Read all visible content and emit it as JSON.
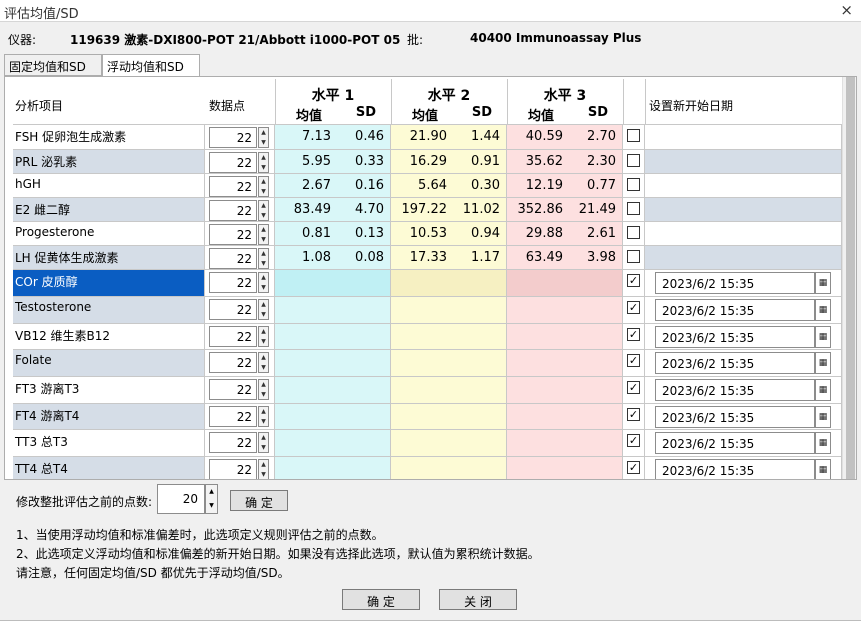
{
  "window": {
    "title": "评估均值/SD",
    "close_glyph": "×"
  },
  "info": {
    "instrument_label": "仪器:",
    "instrument_value": "119639 激素-DXI800-POT 21/Abbott i1000-POT 05",
    "lot_label": "批:",
    "lot_value": "40400 Immunoassay Plus"
  },
  "tabs": [
    {
      "label": "固定均值和SD",
      "active": false
    },
    {
      "label": "浮动均值和SD",
      "active": true
    }
  ],
  "table": {
    "headers": {
      "analyte": "分析项目",
      "count": "数据点",
      "level1": "水平 1",
      "level2": "水平 2",
      "level3": "水平 3",
      "mean": "均值",
      "sd": "SD",
      "new_start": "设置新开始日期"
    },
    "rows": [
      {
        "name": "FSH 促卵泡生成激素",
        "count": "22",
        "m1": "7.13",
        "s1": "0.46",
        "m2": "21.90",
        "s2": "1.44",
        "m3": "40.59",
        "s3": "2.70",
        "checked": false,
        "date": ""
      },
      {
        "name": "PRL 泌乳素",
        "count": "22",
        "m1": "5.95",
        "s1": "0.33",
        "m2": "16.29",
        "s2": "0.91",
        "m3": "35.62",
        "s3": "2.30",
        "checked": false,
        "date": ""
      },
      {
        "name": "hGH",
        "count": "22",
        "m1": "2.67",
        "s1": "0.16",
        "m2": "5.64",
        "s2": "0.30",
        "m3": "12.19",
        "s3": "0.77",
        "checked": false,
        "date": ""
      },
      {
        "name": "E2 雌二醇",
        "count": "22",
        "m1": "83.49",
        "s1": "4.70",
        "m2": "197.22",
        "s2": "11.02",
        "m3": "352.86",
        "s3": "21.49",
        "checked": false,
        "date": ""
      },
      {
        "name": "Progesterone",
        "count": "22",
        "m1": "0.81",
        "s1": "0.13",
        "m2": "10.53",
        "s2": "0.94",
        "m3": "29.88",
        "s3": "2.61",
        "checked": false,
        "date": ""
      },
      {
        "name": "LH 促黄体生成激素",
        "count": "22",
        "m1": "1.08",
        "s1": "0.08",
        "m2": "17.33",
        "s2": "1.17",
        "m3": "63.49",
        "s3": "3.98",
        "checked": false,
        "date": ""
      },
      {
        "name": "COr 皮质醇",
        "count": "22",
        "m1": "",
        "s1": "",
        "m2": "",
        "s2": "",
        "m3": "",
        "s3": "",
        "checked": true,
        "date": "2023/6/2 15:35",
        "selected": true
      },
      {
        "name": "Testosterone",
        "count": "22",
        "m1": "",
        "s1": "",
        "m2": "",
        "s2": "",
        "m3": "",
        "s3": "",
        "checked": true,
        "date": "2023/6/2 15:35"
      },
      {
        "name": "VB12 维生素B12",
        "count": "22",
        "m1": "",
        "s1": "",
        "m2": "",
        "s2": "",
        "m3": "",
        "s3": "",
        "checked": true,
        "date": "2023/6/2 15:35"
      },
      {
        "name": "Folate",
        "count": "22",
        "m1": "",
        "s1": "",
        "m2": "",
        "s2": "",
        "m3": "",
        "s3": "",
        "checked": true,
        "date": "2023/6/2 15:35"
      },
      {
        "name": "FT3 游离T3",
        "count": "22",
        "m1": "",
        "s1": "",
        "m2": "",
        "s2": "",
        "m3": "",
        "s3": "",
        "checked": true,
        "date": "2023/6/2 15:35"
      },
      {
        "name": "FT4 游离T4",
        "count": "22",
        "m1": "",
        "s1": "",
        "m2": "",
        "s2": "",
        "m3": "",
        "s3": "",
        "checked": true,
        "date": "2023/6/2 15:35"
      },
      {
        "name": "TT3 总T3",
        "count": "22",
        "m1": "",
        "s1": "",
        "m2": "",
        "s2": "",
        "m3": "",
        "s3": "",
        "checked": true,
        "date": "2023/6/2 15:35"
      },
      {
        "name": "TT4 总T4",
        "count": "22",
        "m1": "",
        "s1": "",
        "m2": "",
        "s2": "",
        "m3": "",
        "s3": "",
        "checked": true,
        "date": "2023/6/2 15:35"
      }
    ]
  },
  "bottom": {
    "points_label": "修改整批评估之前的点数:",
    "points_value": "20",
    "apply_button": "确 定",
    "notes": [
      "1、当使用浮动均值和标准偏差时，此选项定义规则评估之前的点数。",
      "2、此选项定义浮动均值和标准偏差的新开始日期。如果没有选择此选项，默认值为累积统计数据。",
      "请注意，任何固定均值/SD 都优先于浮动均值/SD。"
    ],
    "ok_button": "确 定",
    "close_button": "关 闭"
  },
  "icons": {
    "spinner": "spinner-icon",
    "calendar": "calendar-icon",
    "check": "checkmark-icon"
  },
  "colors": {
    "level1": "#d9f7f8",
    "level2": "#fdfbd5",
    "level3": "#fde0e0",
    "selected_row": "#0a5dc2",
    "alt_row": "#d5dde7"
  }
}
